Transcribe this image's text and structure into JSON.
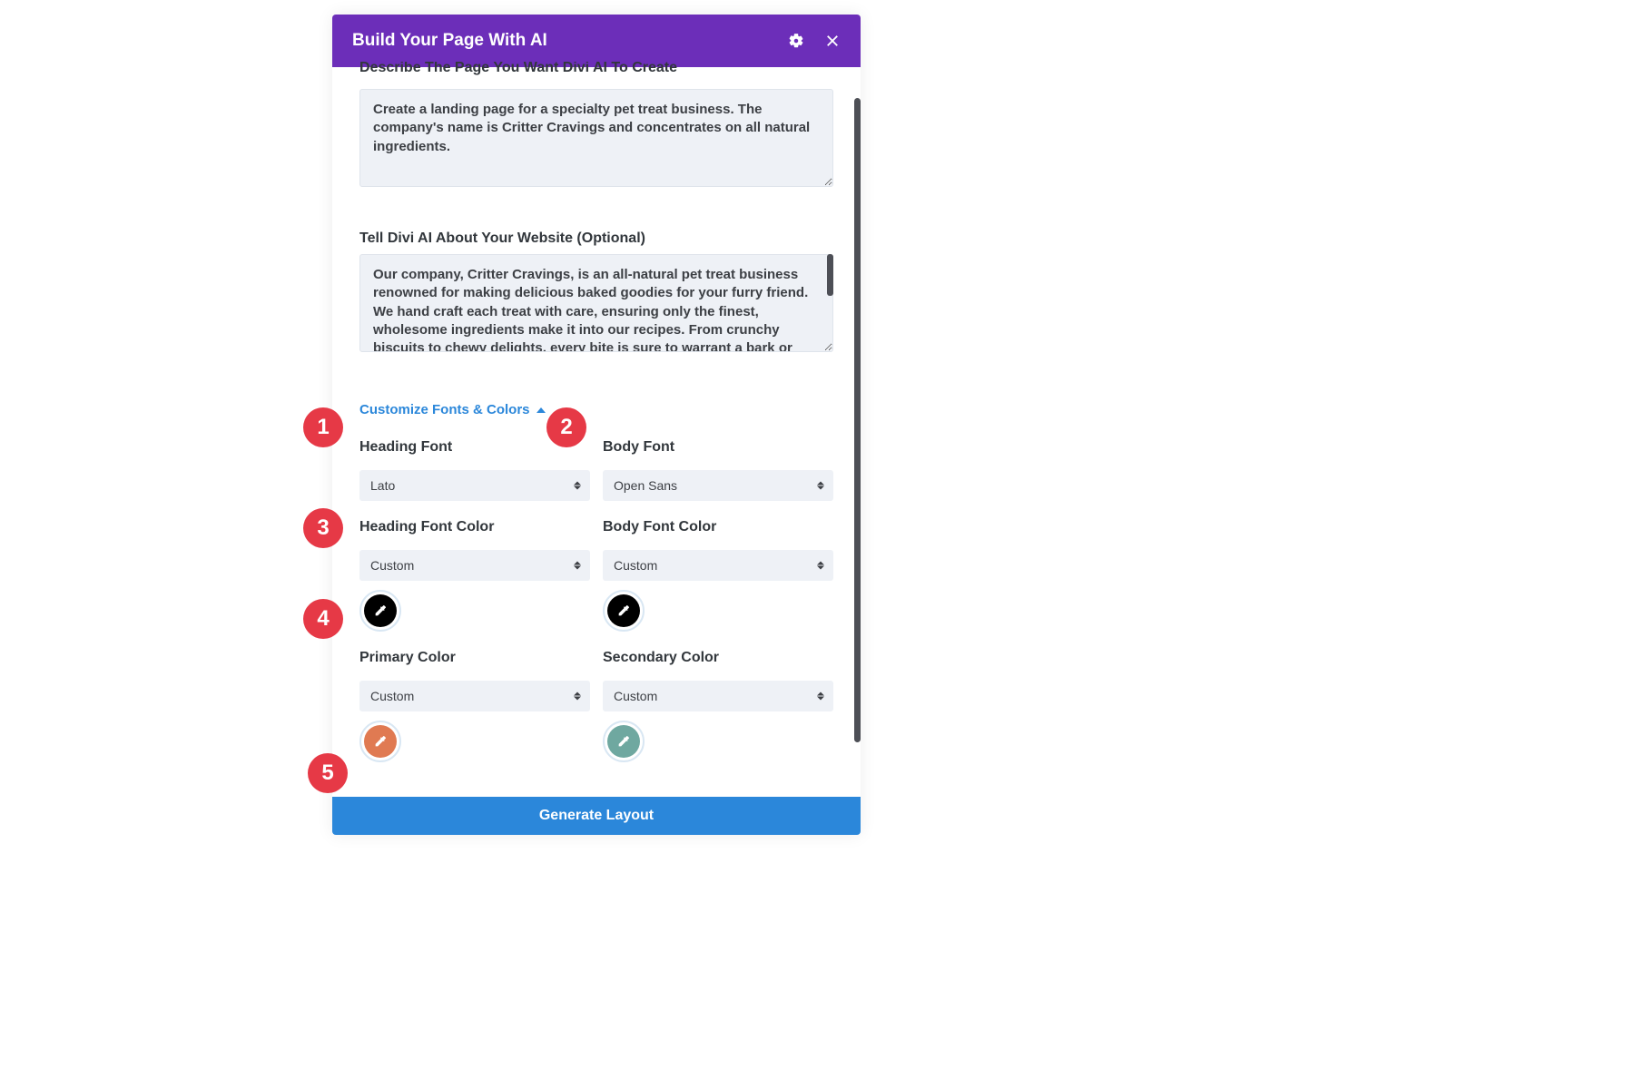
{
  "header": {
    "title": "Build Your Page With AI"
  },
  "prompt1": {
    "partial_label": "Describe The Page You Want Divi AI To Create",
    "value": "Create a landing page for a specialty pet treat business. The company's name is Critter Cravings and concentrates on all natural ingredients."
  },
  "prompt2": {
    "label": "Tell Divi AI About Your Website (Optional)",
    "value": "Our company, Critter Cravings, is an all-natural pet treat business renowned for making delicious baked goodies for your furry friend. We hand craft each treat with care, ensuring only the finest, wholesome ingredients make it into our recipes. From crunchy biscuits to chewy delights, every bite is sure to warrant a bark or meow from your best friend."
  },
  "collapse": {
    "label": "Customize Fonts & Colors"
  },
  "fonts": {
    "heading_label": "Heading Font",
    "heading_value": "Lato",
    "body_label": "Body Font",
    "body_value": "Open Sans"
  },
  "colors": {
    "heading_font_color_label": "Heading Font Color",
    "heading_font_color_value": "Custom",
    "heading_font_color_swatch": "#000000",
    "body_font_color_label": "Body Font Color",
    "body_font_color_value": "Custom",
    "body_font_color_swatch": "#000000",
    "primary_label": "Primary Color",
    "primary_value": "Custom",
    "primary_swatch": "#e07a52",
    "secondary_label": "Secondary Color",
    "secondary_value": "Custom",
    "secondary_swatch": "#6fa8a0"
  },
  "footer": {
    "generate_label": "Generate Layout"
  },
  "annotations": [
    "1",
    "2",
    "3",
    "4",
    "5"
  ]
}
